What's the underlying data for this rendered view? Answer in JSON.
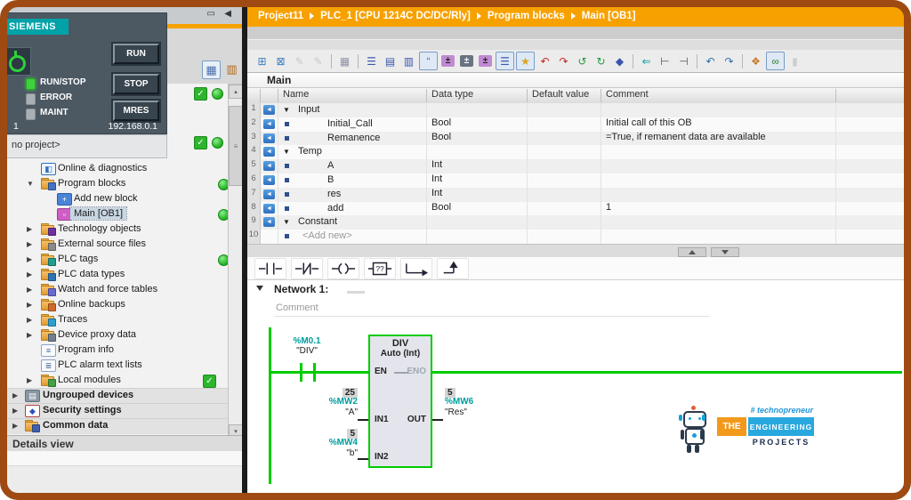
{
  "cpu_panel": {
    "brand": "SIEMENS",
    "leds": [
      {
        "label": "RUN/STOP",
        "state": "on"
      },
      {
        "label": "ERROR",
        "state": "off"
      },
      {
        "label": "MAINT",
        "state": "off"
      }
    ],
    "buttons": [
      "RUN",
      "STOP",
      "MRES"
    ],
    "station": "1",
    "ip": "192.168.0.1",
    "footer": "no project>"
  },
  "left_panel": {
    "header_icons": [
      "panel-float-icon",
      "panel-collapse-icon"
    ],
    "toolbar_icons": [
      "device-view-toggle-icon",
      "configuration-table-icon"
    ],
    "details_view": "Details view",
    "tree": {
      "items": [
        {
          "label": "Online & diagnostics",
          "level": 2,
          "arrow": "none",
          "icon": "diagnostics",
          "status": null
        },
        {
          "label": "Program blocks",
          "level": 2,
          "arrow": "expanded",
          "icon": "folder-blocks",
          "status": "dot"
        },
        {
          "label": "Add new block",
          "level": 3,
          "arrow": "none",
          "icon": "add-block",
          "status": null
        },
        {
          "label": "Main [OB1]",
          "level": 3,
          "arrow": "none",
          "icon": "ob-block",
          "status": "dot",
          "selected": true
        },
        {
          "label": "Technology objects",
          "level": 2,
          "arrow": "collapsed",
          "icon": "folder-tech",
          "status": null
        },
        {
          "label": "External source files",
          "level": 2,
          "arrow": "collapsed",
          "icon": "folder-src",
          "status": null
        },
        {
          "label": "PLC tags",
          "level": 2,
          "arrow": "collapsed",
          "icon": "folder-tags",
          "status": "dot"
        },
        {
          "label": "PLC data types",
          "level": 2,
          "arrow": "collapsed",
          "icon": "folder-types",
          "status": null
        },
        {
          "label": "Watch and force tables",
          "level": 2,
          "arrow": "collapsed",
          "icon": "folder-watch",
          "status": null
        },
        {
          "label": "Online backups",
          "level": 2,
          "arrow": "collapsed",
          "icon": "folder-backup",
          "status": null
        },
        {
          "label": "Traces",
          "level": 2,
          "arrow": "collapsed",
          "icon": "folder-traces",
          "status": null
        },
        {
          "label": "Device proxy data",
          "level": 2,
          "arrow": "collapsed",
          "icon": "folder-proxy",
          "status": null
        },
        {
          "label": "Program info",
          "level": 2,
          "arrow": "none",
          "icon": "page-info",
          "status": null
        },
        {
          "label": "PLC alarm text lists",
          "level": 2,
          "arrow": "none",
          "icon": "page-alarm",
          "status": null
        },
        {
          "label": "Local modules",
          "level": 2,
          "arrow": "collapsed",
          "icon": "folder-modules",
          "status": "check"
        },
        {
          "label": "Ungrouped devices",
          "level": 1,
          "arrow": "collapsed",
          "icon": "device",
          "status": null
        },
        {
          "label": "Security settings",
          "level": 1,
          "arrow": "collapsed",
          "icon": "security",
          "status": null
        },
        {
          "label": "Common data",
          "level": 1,
          "arrow": "collapsed",
          "icon": "folder-common",
          "status": null
        }
      ]
    }
  },
  "breadcrumb": {
    "segments": [
      "Project11",
      "PLC_1 [CPU 1214C DC/DC/Rly]",
      "Program blocks",
      "Main [OB1]"
    ]
  },
  "editor_toolbar": {
    "icons": [
      {
        "name": "insert-network-icon",
        "glyph": "⊞",
        "fg": "#3f7fbf"
      },
      {
        "name": "delete-network-icon",
        "glyph": "⊠",
        "fg": "#3f7fbf"
      },
      {
        "name": "auto-rewire-icon",
        "glyph": "✎",
        "fg": "#9a9a9a",
        "disabled": true
      },
      {
        "name": "manual-rewire-icon",
        "glyph": "✎",
        "fg": "#9a9a9a",
        "disabled": true
      },
      {
        "sep": true
      },
      {
        "name": "block-calls-icon",
        "glyph": "▦",
        "fg": "#8f94a8"
      },
      {
        "sep": true
      },
      {
        "name": "absolute-operands-icon",
        "glyph": "☰",
        "fg": "#3a56b0"
      },
      {
        "name": "expand-networks-icon",
        "glyph": "▤",
        "fg": "#3a56b0"
      },
      {
        "name": "collapse-networks-icon",
        "glyph": "▥",
        "fg": "#3a56b0"
      },
      {
        "name": "network-comments-icon",
        "glyph": "“",
        "fg": "#3a6fd0",
        "boxed": true
      },
      {
        "name": "expand-boxes-icon",
        "glyph": "±",
        "fg": "#222222",
        "bg": "#c08ad2"
      },
      {
        "name": "collapse-boxes-icon",
        "glyph": "±",
        "fg": "#ffffff",
        "bg": "#6a7480"
      },
      {
        "name": "expand-operands-icon",
        "glyph": "±",
        "fg": "#222222",
        "bg": "#c08ad2"
      },
      {
        "name": "hidden-parameters-icon",
        "glyph": "☰",
        "fg": "#3a56b0",
        "boxed": true
      },
      {
        "name": "favorites-wand-icon",
        "glyph": "★",
        "fg": "#d9a520",
        "boxed": true
      },
      {
        "name": "previous-error-icon",
        "glyph": "↶",
        "fg": "#cc2222"
      },
      {
        "name": "next-error-icon",
        "glyph": "↷",
        "fg": "#cc2222"
      },
      {
        "name": "update-inconsistent-icon",
        "glyph": "↺",
        "fg": "#1e9e3e"
      },
      {
        "name": "refresh-icon",
        "glyph": "↻",
        "fg": "#1e9e3e"
      },
      {
        "name": "consistency-check-icon",
        "glyph": "◆",
        "fg": "#3a56b0"
      },
      {
        "sep": true
      },
      {
        "name": "negate-contact-icon",
        "glyph": "⇐",
        "fg": "#0a9aa0"
      },
      {
        "name": "positive-edge-icon",
        "glyph": "⊢",
        "fg": "#555555"
      },
      {
        "name": "negative-edge-icon",
        "glyph": "⊣",
        "fg": "#555555"
      },
      {
        "sep": true
      },
      {
        "name": "undo-icon",
        "glyph": "↶",
        "fg": "#2f6fae"
      },
      {
        "name": "redo-icon",
        "glyph": "↷",
        "fg": "#2f6fae"
      },
      {
        "sep": true
      },
      {
        "name": "know-how-protection-icon",
        "glyph": "❖",
        "fg": "#c87820"
      },
      {
        "name": "monitoring-toggle-icon",
        "glyph": "∞",
        "fg": "#2a7e2a",
        "boxed": true
      },
      {
        "name": "snapshot-icon",
        "glyph": "▮",
        "fg": "#a8a8a8",
        "disabled": true
      }
    ]
  },
  "interface_table": {
    "title": "Main",
    "columns": [
      "Name",
      "Data type",
      "Default value",
      "Comment"
    ],
    "rows": [
      {
        "num": "1",
        "section": true,
        "name": "Input",
        "type": "",
        "default": "",
        "comment": ""
      },
      {
        "num": "2",
        "name": "Initial_Call",
        "type": "Bool",
        "default": "",
        "comment": "Initial call of this OB"
      },
      {
        "num": "3",
        "name": "Remanence",
        "type": "Bool",
        "default": "",
        "comment": "=True, if remanent data are available"
      },
      {
        "num": "4",
        "section": true,
        "name": "Temp",
        "type": "",
        "default": "",
        "comment": ""
      },
      {
        "num": "5",
        "name": "A",
        "type": "Int",
        "default": "",
        "comment": ""
      },
      {
        "num": "6",
        "name": "B",
        "type": "Int",
        "default": "",
        "comment": ""
      },
      {
        "num": "7",
        "name": "res",
        "type": "Int",
        "default": "",
        "comment": ""
      },
      {
        "num": "8",
        "name": "add",
        "type": "Bool",
        "default": "",
        "comment": "1"
      },
      {
        "num": "9",
        "section": true,
        "name": "Constant",
        "type": "",
        "default": "",
        "comment": ""
      },
      {
        "num": "10",
        "name": "<Add new>",
        "placeholder": true,
        "type": "",
        "default": "",
        "comment": ""
      }
    ]
  },
  "favorites": {
    "items": [
      {
        "name": "no-contact-icon"
      },
      {
        "name": "nc-contact-icon"
      },
      {
        "name": "coil-icon"
      },
      {
        "name": "empty-box-icon"
      },
      {
        "name": "open-branch-icon"
      },
      {
        "name": "close-branch-icon"
      }
    ]
  },
  "network": {
    "title": "Network 1:",
    "comment_placeholder": "Comment"
  },
  "ladder": {
    "contact": {
      "address": "%M0.1",
      "tag": "\"DIV\""
    },
    "block": {
      "title": "DIV",
      "mode": "Auto (Int)",
      "pins": {
        "en": "EN",
        "eno": "ENO",
        "in1": "IN1",
        "in2": "IN2",
        "out": "OUT"
      }
    },
    "operands": {
      "in1": {
        "value": "25",
        "address": "%MW2",
        "tag": "\"A\""
      },
      "in2": {
        "value": "5",
        "address": "%MW4",
        "tag": "\"b\""
      },
      "out": {
        "value": "5",
        "address": "%MW6",
        "tag": "\"Res\""
      }
    },
    "status_color": "#00cc00",
    "address_color": "#009c9c"
  },
  "watermark": {
    "hashtag": "# technopreneur",
    "line1": "THE",
    "line2": "ENGINEERING",
    "line3": "PROJECTS"
  }
}
